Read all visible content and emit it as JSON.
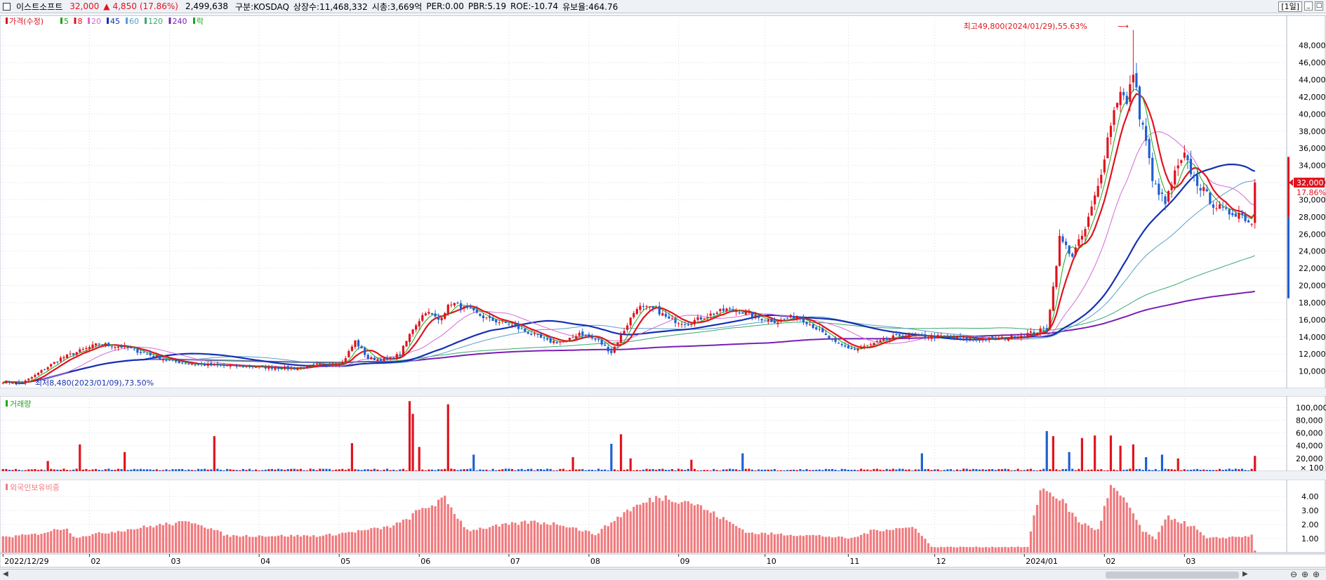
{
  "header": {
    "name": "이스트소프트",
    "price": "32,000",
    "change_arrow": "▲",
    "change": "4,850",
    "change_pct": "(17.86%)",
    "volume": "2,499,638",
    "market": "구분:KOSDAQ",
    "shares": "상장수:11,468,332",
    "mcap": "시총:3,669억",
    "per": "PER:0.00",
    "pbr": "PBR:5.19",
    "roe": "ROE:-10.74",
    "reserve": "유보율:464.76",
    "period_label": "[1일]",
    "up_color": "#e0141e",
    "down_color": "#1f5fd0"
  },
  "chart_data": {
    "type": "candlestick",
    "x_tick_labels": [
      "2022/12/29",
      "02",
      "03",
      "04",
      "05",
      "06",
      "07",
      "08",
      "09",
      "10",
      "11",
      "12",
      "2024/01",
      "02",
      "03"
    ],
    "price_panel": {
      "legend": [
        {
          "label": "가격(수정)",
          "color": "#d4141e"
        },
        {
          "label": "5",
          "color": "#1ea51e"
        },
        {
          "label": "8",
          "color": "#e0141e"
        },
        {
          "label": "20",
          "color": "#d46ad4"
        },
        {
          "label": "45",
          "color": "#1430b4"
        },
        {
          "label": "60",
          "color": "#5aa0c8"
        },
        {
          "label": "120",
          "color": "#3aa870"
        },
        {
          "label": "240",
          "color": "#7a1fb4"
        },
        {
          "label": "락",
          "color": "#1ea51e"
        }
      ],
      "y_ticks": [
        "10,000",
        "12,000",
        "14,000",
        "16,000",
        "18,000",
        "20,000",
        "22,000",
        "24,000",
        "26,000",
        "28,000",
        "30,000",
        "32,000",
        "34,000",
        "36,000",
        "38,000",
        "40,000",
        "42,000",
        "44,000",
        "46,000",
        "48,000"
      ],
      "ylim": [
        8000,
        51500
      ],
      "max_annotation": "최고49,800(2024/01/29),55.63%",
      "min_annotation": "최저8,480(2023/01/09),73.50%",
      "last_price_label": "32,000",
      "last_pct_label": "17.86%",
      "anchors": [
        [
          0,
          8800
        ],
        [
          6,
          8600
        ],
        [
          10,
          9500
        ],
        [
          18,
          11500
        ],
        [
          25,
          12500
        ],
        [
          30,
          13200
        ],
        [
          38,
          12800
        ],
        [
          45,
          12000
        ],
        [
          52,
          11200
        ],
        [
          60,
          10800
        ],
        [
          70,
          10600
        ],
        [
          80,
          10500
        ],
        [
          90,
          10300
        ],
        [
          100,
          10800
        ],
        [
          106,
          11000
        ],
        [
          110,
          13500
        ],
        [
          114,
          11500
        ],
        [
          120,
          11300
        ],
        [
          124,
          12000
        ],
        [
          128,
          15000
        ],
        [
          132,
          17000
        ],
        [
          136,
          16000
        ],
        [
          140,
          18000
        ],
        [
          146,
          17000
        ],
        [
          152,
          16000
        ],
        [
          158,
          15500
        ],
        [
          164,
          14500
        ],
        [
          170,
          13500
        ],
        [
          176,
          13400
        ],
        [
          180,
          14500
        ],
        [
          186,
          13500
        ],
        [
          190,
          12200
        ],
        [
          194,
          14800
        ],
        [
          198,
          17500
        ],
        [
          204,
          17200
        ],
        [
          208,
          16000
        ],
        [
          214,
          15600
        ],
        [
          220,
          16500
        ],
        [
          226,
          17200
        ],
        [
          230,
          17000
        ],
        [
          236,
          16200
        ],
        [
          242,
          15800
        ],
        [
          248,
          16500
        ],
        [
          254,
          15000
        ],
        [
          260,
          13200
        ],
        [
          266,
          12500
        ],
        [
          272,
          13200
        ],
        [
          280,
          14200
        ],
        [
          288,
          14000
        ],
        [
          296,
          14000
        ],
        [
          304,
          13700
        ],
        [
          312,
          13800
        ],
        [
          318,
          14200
        ],
        [
          322,
          14500
        ],
        [
          326,
          15000
        ],
        [
          328,
          19800
        ],
        [
          330,
          25500
        ],
        [
          334,
          23500
        ],
        [
          338,
          26500
        ],
        [
          342,
          31500
        ],
        [
          346,
          39000
        ],
        [
          349,
          43000
        ],
        [
          351,
          41000
        ],
        [
          353,
          45000
        ],
        [
          355,
          40000
        ],
        [
          357,
          37000
        ],
        [
          359,
          32000
        ],
        [
          361,
          31000
        ],
        [
          363,
          29500
        ],
        [
          366,
          33000
        ],
        [
          369,
          35000
        ],
        [
          372,
          32500
        ],
        [
          375,
          31000
        ],
        [
          378,
          29500
        ],
        [
          382,
          28500
        ],
        [
          386,
          28500
        ],
        [
          390,
          27200
        ],
        [
          391,
          32000
        ]
      ]
    },
    "volume_panel": {
      "legend": "거래량",
      "y_ticks": [
        "20,000",
        "40,000",
        "60,000",
        "80,000",
        "100,000"
      ],
      "unit_label": "× 100",
      "spikes": [
        [
          14,
          16
        ],
        [
          24,
          42
        ],
        [
          38,
          30
        ],
        [
          66,
          55
        ],
        [
          109,
          44
        ],
        [
          127,
          110
        ],
        [
          128,
          90
        ],
        [
          130,
          38
        ],
        [
          139,
          105
        ],
        [
          147,
          26
        ],
        [
          178,
          22
        ],
        [
          190,
          43
        ],
        [
          193,
          58
        ],
        [
          196,
          20
        ],
        [
          215,
          18
        ],
        [
          231,
          28
        ],
        [
          287,
          28
        ],
        [
          326,
          63
        ],
        [
          328,
          55
        ],
        [
          333,
          30
        ],
        [
          337,
          52
        ],
        [
          341,
          56
        ],
        [
          346,
          56
        ],
        [
          349,
          40
        ],
        [
          353,
          42
        ],
        [
          357,
          22
        ],
        [
          362,
          26
        ],
        [
          367,
          20
        ],
        [
          391,
          24
        ]
      ]
    },
    "foreign_panel": {
      "legend": "외국인보유비중",
      "y_ticks": [
        "1.00",
        "2.00",
        "3.00",
        "4.00"
      ],
      "ylim": [
        0,
        5.2
      ],
      "anchors": [
        [
          0,
          1.1
        ],
        [
          10,
          1.3
        ],
        [
          20,
          1.8
        ],
        [
          22,
          1.1
        ],
        [
          50,
          2.0
        ],
        [
          60,
          2.2
        ],
        [
          70,
          1.2
        ],
        [
          100,
          1.2
        ],
        [
          120,
          1.8
        ],
        [
          125,
          2.2
        ],
        [
          130,
          3.0
        ],
        [
          138,
          3.8
        ],
        [
          145,
          1.6
        ],
        [
          165,
          2.2
        ],
        [
          175,
          2.0
        ],
        [
          185,
          1.3
        ],
        [
          195,
          3.0
        ],
        [
          205,
          4.0
        ],
        [
          215,
          3.6
        ],
        [
          225,
          2.4
        ],
        [
          233,
          1.4
        ],
        [
          255,
          1.2
        ],
        [
          265,
          1.0
        ],
        [
          272,
          1.6
        ],
        [
          285,
          1.8
        ],
        [
          290,
          0.4
        ],
        [
          320,
          0.4
        ],
        [
          324,
          4.6
        ],
        [
          330,
          3.9
        ],
        [
          336,
          2.2
        ],
        [
          342,
          1.6
        ],
        [
          346,
          4.7
        ],
        [
          352,
          3.2
        ],
        [
          356,
          1.5
        ],
        [
          360,
          1.0
        ],
        [
          364,
          2.6
        ],
        [
          372,
          1.8
        ],
        [
          376,
          1.0
        ],
        [
          390,
          1.2
        ]
      ]
    }
  }
}
